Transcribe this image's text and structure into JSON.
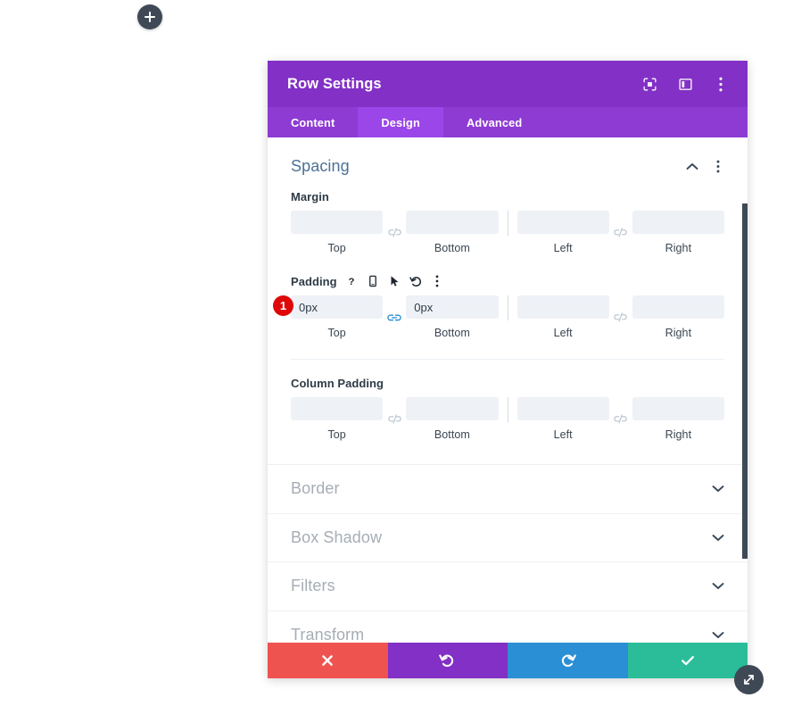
{
  "canvas": {
    "add_button_icon": "plus-icon"
  },
  "modal": {
    "title": "Row Settings",
    "header_icons": [
      {
        "name": "focus-target-icon",
        "label": ""
      },
      {
        "name": "layout-panel-icon",
        "label": ""
      },
      {
        "name": "vertical-dots-icon",
        "label": ""
      }
    ],
    "tabs": [
      {
        "label": "Content",
        "active": false
      },
      {
        "label": "Design",
        "active": true
      },
      {
        "label": "Advanced",
        "active": false
      }
    ],
    "open_section": {
      "title": "Spacing",
      "collapse_icon": "chevron-up-icon",
      "menu_icon": "vertical-dots-icon",
      "groups": [
        {
          "label": "Margin",
          "icons": [],
          "badge": null,
          "link_left": {
            "icon": "unlink-icon",
            "linked": false
          },
          "link_right": {
            "icon": "unlink-icon",
            "linked": false
          },
          "fields": [
            {
              "caption": "Top",
              "value": "",
              "placeholder": ""
            },
            {
              "caption": "Bottom",
              "value": "",
              "placeholder": ""
            },
            {
              "caption": "Left",
              "value": "",
              "placeholder": ""
            },
            {
              "caption": "Right",
              "value": "",
              "placeholder": ""
            }
          ]
        },
        {
          "label": "Padding",
          "icons": [
            {
              "name": "help-question-icon"
            },
            {
              "name": "mobile-phone-icon"
            },
            {
              "name": "cursor-arrow-icon"
            },
            {
              "name": "reset-undo-icon"
            },
            {
              "name": "vertical-dots-icon"
            }
          ],
          "badge": "1",
          "link_left": {
            "icon": "link-icon",
            "linked": true
          },
          "link_right": {
            "icon": "unlink-icon",
            "linked": false
          },
          "fields": [
            {
              "caption": "Top",
              "value": "0px",
              "placeholder": ""
            },
            {
              "caption": "Bottom",
              "value": "0px",
              "placeholder": ""
            },
            {
              "caption": "Left",
              "value": "",
              "placeholder": ""
            },
            {
              "caption": "Right",
              "value": "",
              "placeholder": ""
            }
          ]
        },
        {
          "label": "Column Padding",
          "icons": [],
          "badge": null,
          "link_left": {
            "icon": "unlink-icon",
            "linked": false
          },
          "link_right": {
            "icon": "unlink-icon",
            "linked": false
          },
          "fields": [
            {
              "caption": "Top",
              "value": "",
              "placeholder": ""
            },
            {
              "caption": "Bottom",
              "value": "",
              "placeholder": ""
            },
            {
              "caption": "Left",
              "value": "",
              "placeholder": ""
            },
            {
              "caption": "Right",
              "value": "",
              "placeholder": ""
            }
          ]
        }
      ]
    },
    "closed_sections": [
      {
        "title": "Border",
        "icon": "chevron-down-icon"
      },
      {
        "title": "Box Shadow",
        "icon": "chevron-down-icon"
      },
      {
        "title": "Filters",
        "icon": "chevron-down-icon"
      },
      {
        "title": "Transform",
        "icon": "chevron-down-icon"
      }
    ],
    "footer_buttons": [
      {
        "name": "cancel-button",
        "icon": "close-x-icon",
        "color": "#ef5350"
      },
      {
        "name": "undo-button",
        "icon": "undo-arrow-icon",
        "color": "#8230c6"
      },
      {
        "name": "redo-button",
        "icon": "redo-arrow-icon",
        "color": "#2a8fd4"
      },
      {
        "name": "save-button",
        "icon": "checkmark-icon",
        "color": "#2bbd9a"
      }
    ],
    "resize_handle_icon": "resize-diagonal-icon"
  },
  "colors": {
    "header_purple": "#8230c6",
    "tabbar_purple": "#8e3bd4",
    "tab_active_purple": "#9b46e8",
    "section_title_blue": "#4c7195",
    "badge_red": "#de0808",
    "link_blue": "#2a8fd4"
  }
}
